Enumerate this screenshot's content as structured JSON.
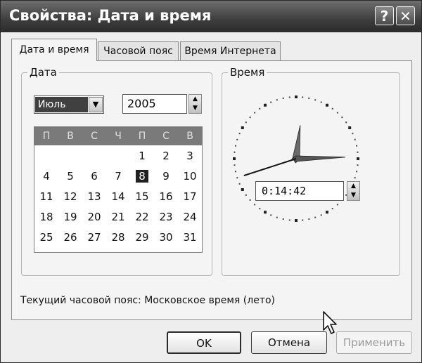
{
  "window": {
    "title": "Свойства: Дата и время",
    "help_label": "?",
    "close_label": "✕"
  },
  "tabs": [
    {
      "label": "Дата и время",
      "active": true
    },
    {
      "label": "Часовой пояс",
      "active": false
    },
    {
      "label": "Время Интернета",
      "active": false
    }
  ],
  "date": {
    "group_title": "Дата",
    "month": "Июль",
    "year": "2005",
    "weekdays": [
      "П",
      "В",
      "С",
      "Ч",
      "П",
      "С",
      "В"
    ],
    "days": [
      "",
      "",
      "",
      "",
      "1",
      "2",
      "3",
      "4",
      "5",
      "6",
      "7",
      "8",
      "9",
      "10",
      "11",
      "12",
      "13",
      "14",
      "15",
      "16",
      "17",
      "18",
      "19",
      "20",
      "21",
      "22",
      "23",
      "24",
      "25",
      "26",
      "27",
      "28",
      "29",
      "30",
      "31"
    ],
    "selected_day": "8"
  },
  "time": {
    "group_title": "Время",
    "value": "0:14:42",
    "hours": 0,
    "minutes": 14,
    "seconds": 42
  },
  "timezone_text": "Текущий часовой пояс: Московское время (лето)",
  "buttons": {
    "ok": "OK",
    "cancel": "Отмена",
    "apply": "Применить"
  },
  "colors": {
    "titlebar": "#3e3e3e",
    "calendar_header": "#7a7a7a",
    "selection": "#202020"
  }
}
